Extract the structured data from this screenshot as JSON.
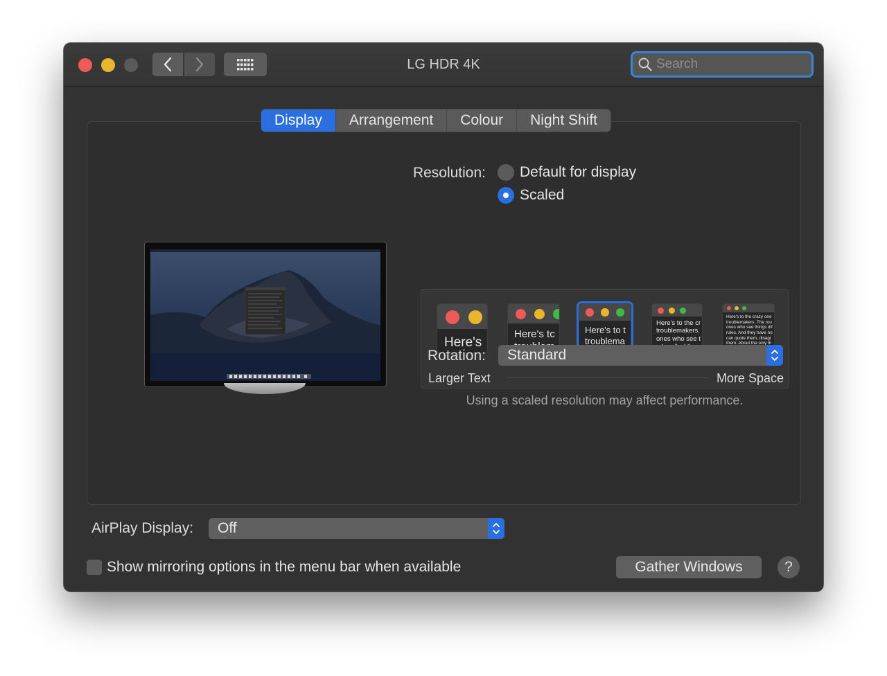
{
  "window": {
    "title": "LG HDR 4K"
  },
  "toolbar": {
    "search_placeholder": "Search"
  },
  "tabs": [
    {
      "label": "Display",
      "active": true
    },
    {
      "label": "Arrangement",
      "active": false
    },
    {
      "label": "Colour",
      "active": false
    },
    {
      "label": "Night Shift",
      "active": false
    }
  ],
  "resolution": {
    "label": "Resolution:",
    "options": [
      {
        "label": "Default for display",
        "selected": false
      },
      {
        "label": "Scaled",
        "selected": true
      }
    ],
    "scale_options": [
      {
        "text": "Here's",
        "selected": false
      },
      {
        "text": "Here's tc\ntroublem",
        "selected": false
      },
      {
        "text": "Here's to t\ntroublema\nones who",
        "selected": true
      },
      {
        "text": "Here's to the cr\ntroublemakers.\nones who see t\nrules. And they",
        "selected": false
      },
      {
        "text": "Here's to the crazy one\ntroublemakers. The rou\nones who see things dif\nrules. And they have no\ncan quote them, disagr\nthem. About the only th\nBecause they change t",
        "selected": false
      }
    ],
    "larger_label": "Larger Text",
    "more_label": "More Space",
    "note": "Using a scaled resolution may affect performance."
  },
  "rotation": {
    "label": "Rotation:",
    "value": "Standard"
  },
  "airplay": {
    "label": "AirPlay Display:",
    "value": "Off"
  },
  "mirroring": {
    "label": "Show mirroring options in the menu bar when available",
    "checked": false
  },
  "buttons": {
    "gather": "Gather Windows",
    "help": "?"
  },
  "colors": {
    "accent": "#2a6ee0",
    "close": "#ee5b56",
    "minimize": "#e9b62c",
    "zoom_disabled": "#5a5a5a"
  }
}
